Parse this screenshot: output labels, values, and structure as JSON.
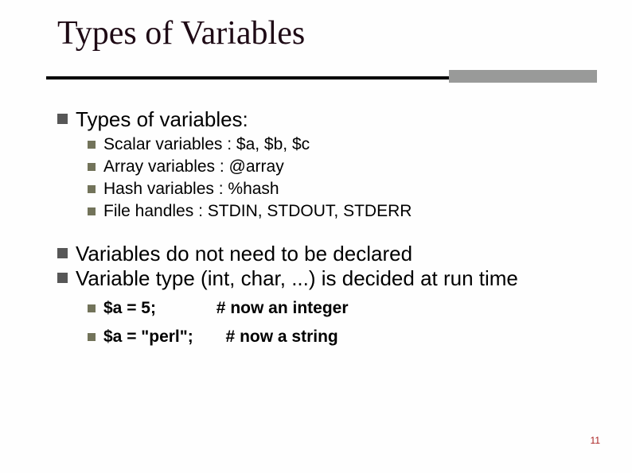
{
  "title": "Types of Variables",
  "section1": {
    "heading": "Types of variables:",
    "items": [
      "Scalar variables :  $a, $b, $c",
      "Array variables :   @array",
      "Hash variables  :   %hash",
      "File handles : STDIN, STDOUT, STDERR"
    ]
  },
  "section2": {
    "line1": "Variables do not need to be declared",
    "line2": "Variable type (int, char, ...) is decided at run time",
    "examples": [
      "$a = 5;             # now an integer",
      "$a = \"perl\";       # now a string"
    ]
  },
  "page_number": "11"
}
